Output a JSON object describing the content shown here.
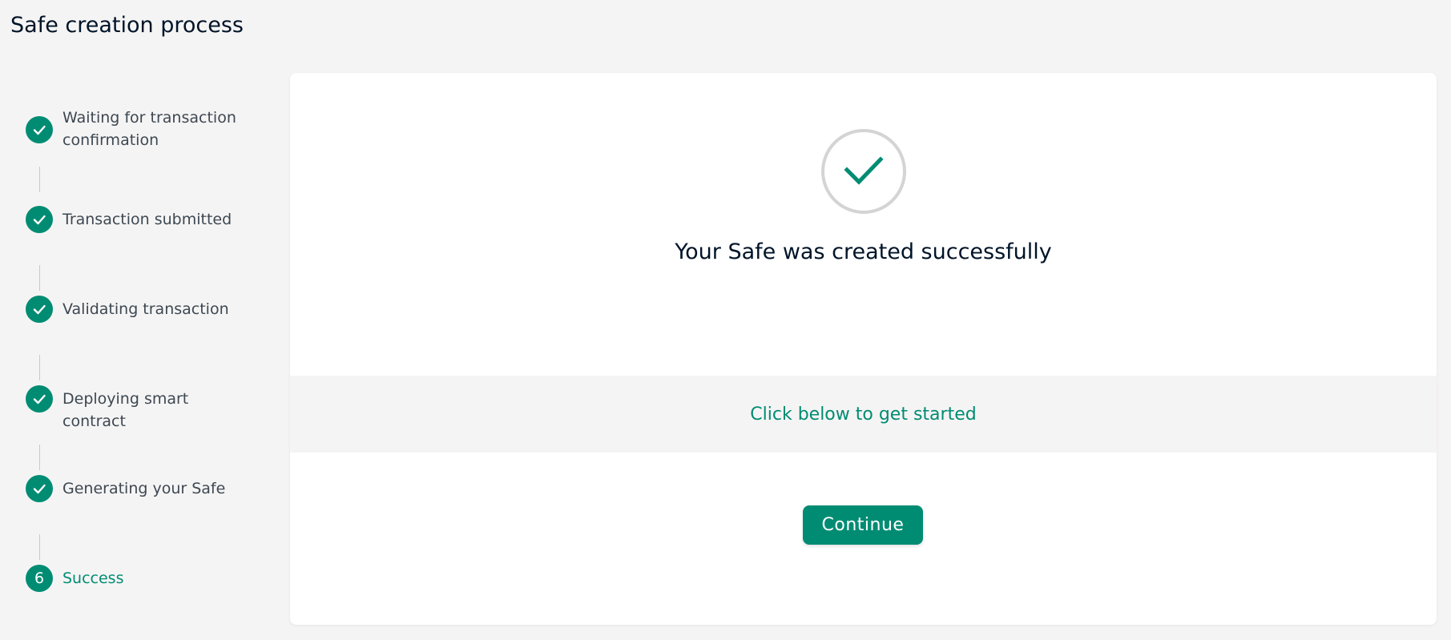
{
  "page": {
    "title": "Safe creation process"
  },
  "steps": [
    {
      "label": "Waiting for transaction confirmation",
      "status": "done",
      "icon": "check-icon"
    },
    {
      "label": "Transaction submitted",
      "status": "done",
      "icon": "check-icon"
    },
    {
      "label": "Validating transaction",
      "status": "done",
      "icon": "check-icon"
    },
    {
      "label": "Deploying smart contract",
      "status": "done",
      "icon": "check-icon"
    },
    {
      "label": "Generating your Safe",
      "status": "done",
      "icon": "check-icon"
    },
    {
      "label": "Success",
      "status": "active",
      "number": "6"
    }
  ],
  "main": {
    "success_icon": "check-circle-icon",
    "success_message": "Your Safe was created successfully",
    "prompt": "Click below to get started",
    "continue_label": "Continue"
  },
  "colors": {
    "accent": "#008c73",
    "background": "#f5f4f4",
    "card": "#ffffff",
    "text": "#001428"
  }
}
